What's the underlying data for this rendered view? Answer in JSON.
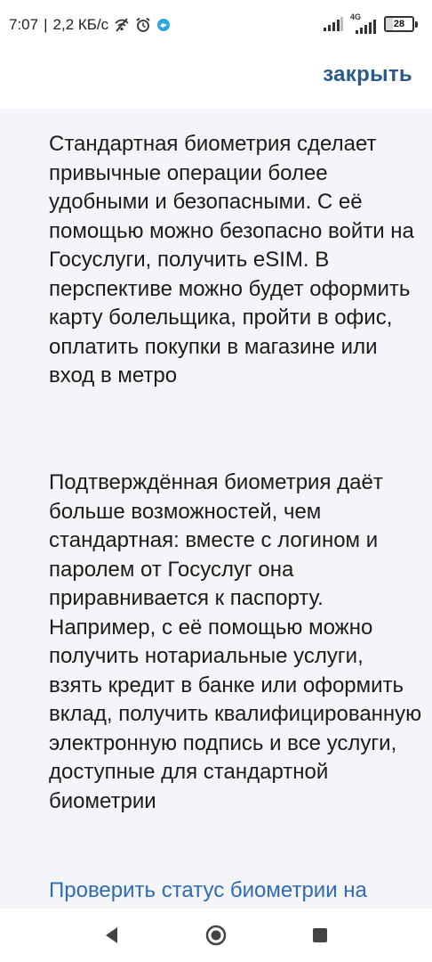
{
  "status_bar": {
    "time": "7:07",
    "separator": "|",
    "speed": "2,2 КБ/с",
    "network_label": "4G",
    "battery": "28",
    "battery_level": 0.28,
    "icons": [
      "wifi-off-icon",
      "alarm-icon",
      "app-notification-icon",
      "signal-icon",
      "signal-4g-icon",
      "battery-icon"
    ]
  },
  "header": {
    "close_label": "закрыть",
    "accent_color": "#2a5a8c"
  },
  "content": {
    "paragraph_1": "Стандартная биометрия сделает привычные операции более удобными и безопасными. С её помощью можно безопасно войти на Госуслуги, получить eSIM. В перспективе можно будет оформить карту болельщика, пройти в офис, оплатить покупки в магазине или вход в метро",
    "paragraph_2": "Подтверждённая биометрия даёт больше возможностей, чем стандартная: вместе с логином и паролем от Госуслуг она приравнивается к паспорту. Например, с её помощью можно получить нотариальные услуги, взять кредит в банке или оформить вклад, получить квалифицированную электронную подпись и все услуги, доступные для стандартной биометрии",
    "status_link": "Проверить статус биометрии на",
    "link_color": "#2f6bb3",
    "background_color": "#f3f5f8"
  },
  "nav_bar": {
    "buttons": [
      "back-icon",
      "home-icon",
      "recent-apps-icon"
    ]
  }
}
